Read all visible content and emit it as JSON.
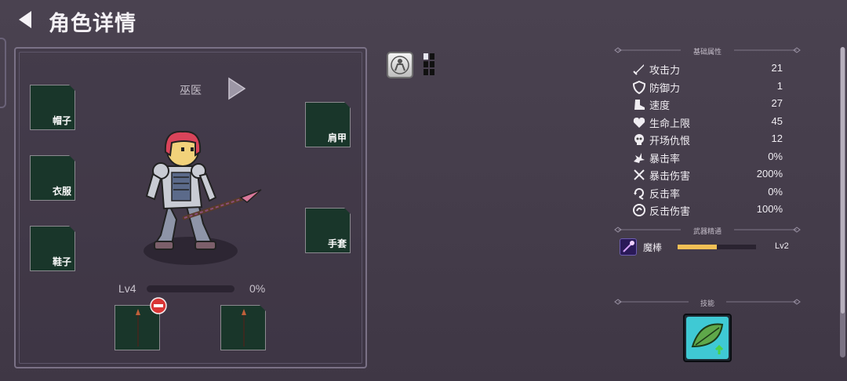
{
  "header": {
    "title": "角色详情",
    "back_icon": "back-arrow-icon"
  },
  "character": {
    "class_name": "巫医",
    "level_label": "Lv4",
    "exp_percent_label": "0%",
    "exp_fraction": 0.0
  },
  "equipment": {
    "hat": "帽子",
    "clothes": "衣服",
    "shoes": "鞋子",
    "shoulder": "肩甲",
    "gloves": "手套"
  },
  "sections": {
    "basic_attributes": "基础属性",
    "weapon_mastery": "武器精通",
    "skills": "技能"
  },
  "stats": [
    {
      "icon": "sword-icon",
      "name": "攻击力",
      "value": "21"
    },
    {
      "icon": "shield-icon",
      "name": "防御力",
      "value": "1"
    },
    {
      "icon": "boot-icon",
      "name": "速度",
      "value": "27"
    },
    {
      "icon": "heart-icon",
      "name": "生命上限",
      "value": "45"
    },
    {
      "icon": "skull-icon",
      "name": "开场仇恨",
      "value": "12"
    },
    {
      "icon": "burst-icon",
      "name": "暴击率",
      "value": "0%"
    },
    {
      "icon": "crossed-swords-icon",
      "name": "暴击伤害",
      "value": "200%"
    },
    {
      "icon": "counter-icon",
      "name": "反击率",
      "value": "0%"
    },
    {
      "icon": "spiral-icon",
      "name": "反击伤害",
      "value": "100%"
    }
  ],
  "mastery": {
    "name": "魔棒",
    "level": "Lv2",
    "progress_fraction": 0.5
  },
  "colors": {
    "slot_bg": "#19362a",
    "mastery_fill": "#f2c055",
    "accent_red": "#d93636"
  }
}
